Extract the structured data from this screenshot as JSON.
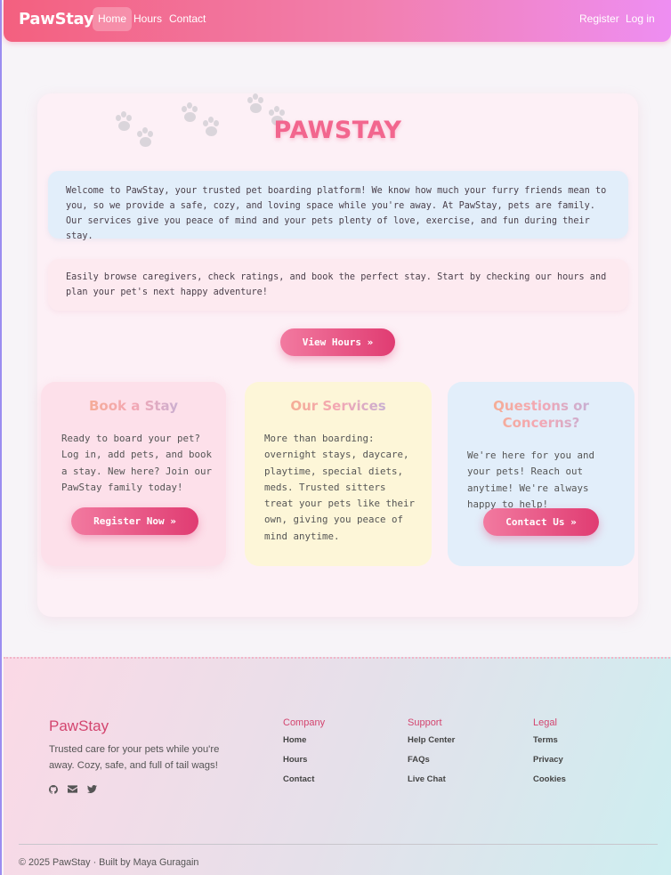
{
  "nav": {
    "brand": "PawStay",
    "links": [
      "Home",
      "Hours",
      "Contact"
    ],
    "right_links": [
      "Register",
      "Log in"
    ]
  },
  "hero": {
    "title": "PAWSTAY",
    "welcome": "Welcome to PawStay, your trusted pet boarding platform! We know how much your furry friends mean to you, so we provide a safe, cozy, and loving space while you're away. At PawStay, pets are family. Our services give you peace of mind and your pets plenty of love, exercise, and fun during their stay.",
    "browse": "Easily browse caregivers, check ratings, and book the perfect stay. Start by checking our hours and plan your pet's next happy adventure!",
    "cta": "View Hours »"
  },
  "features": [
    {
      "title": "Book a Stay",
      "text": "Ready to board your pet? Log in, add pets, and book a stay. New here? Join our PawStay family today!",
      "button": "Register Now »"
    },
    {
      "title": "Our Services",
      "text": "More than boarding: overnight stays, daycare, playtime, special diets, meds. Trusted sitters treat your pets like their own, giving you peace of mind anytime."
    },
    {
      "title": "Questions or Concerns?",
      "text": "We're here for you and your pets! Reach out anytime! We're always happy to help!",
      "button": "Contact Us »"
    }
  ],
  "footer": {
    "brand": "PawStay",
    "description": "Trusted care for your pets while you're away. Cozy, safe, and full of tail wags!",
    "icons": [
      "github-icon",
      "envelope-icon",
      "twitter-icon"
    ],
    "columns": [
      {
        "heading": "Company",
        "links": [
          "Home",
          "Hours",
          "Contact"
        ]
      },
      {
        "heading": "Support",
        "links": [
          "Help Center",
          "FAQs",
          "Live Chat"
        ]
      },
      {
        "heading": "Legal",
        "links": [
          "Terms",
          "Privacy",
          "Cookies"
        ]
      }
    ],
    "copyright": "© 2025 PawStay · Built by Maya Guragain"
  },
  "colors": {
    "nav_gradient_start": "#f3607f",
    "nav_gradient_end": "#ee8ef2",
    "accent": "#e03c72",
    "title_pink": "#f2668e",
    "footer_accent": "#d3456f"
  }
}
